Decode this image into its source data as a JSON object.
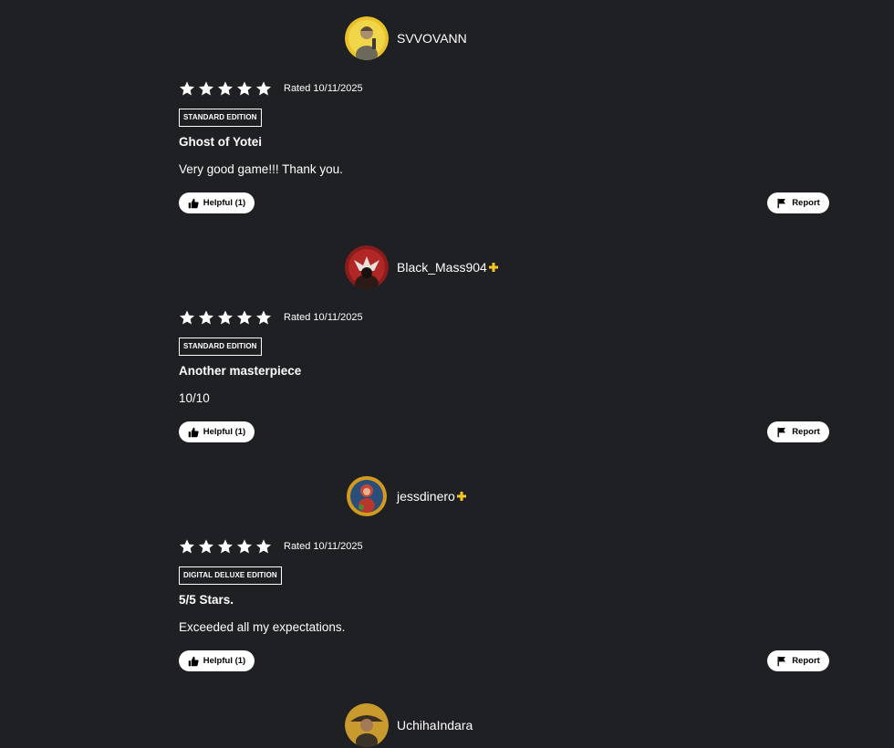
{
  "reviews": [
    {
      "username": "SVVOVANN",
      "ps_plus": false,
      "rating": 5,
      "rated_text": "Rated 10/11/2025",
      "edition": "STANDARD EDITION",
      "title": "Ghost of Yotei",
      "body": "Very good game!!! Thank you.",
      "helpful_label": "Helpful (1)",
      "report_label": "Report"
    },
    {
      "username": "Black_Mass904",
      "ps_plus": true,
      "rating": 5,
      "rated_text": "Rated 10/11/2025",
      "edition": "STANDARD EDITION",
      "title": "Another masterpiece",
      "body": "10/10",
      "helpful_label": "Helpful (1)",
      "report_label": "Report"
    },
    {
      "username": "jessdinero",
      "ps_plus": true,
      "rating": 5,
      "rated_text": "Rated 10/11/2025",
      "edition": "DIGITAL DELUXE EDITION",
      "title": "5/5 Stars.",
      "body": "Exceeded all my expectations.",
      "helpful_label": "Helpful (1)",
      "report_label": "Report"
    },
    {
      "username": "UchihaIndara",
      "ps_plus": false
    }
  ],
  "colors": {
    "background": "#1f2023",
    "text": "#ffffff",
    "plus": "#f6c623",
    "button_bg": "#ffffff",
    "button_text": "#000000"
  },
  "icons": {
    "star": "star-icon",
    "plus": "ps-plus-icon",
    "helpful": "thumbs-up-icon",
    "report": "flag-icon"
  }
}
